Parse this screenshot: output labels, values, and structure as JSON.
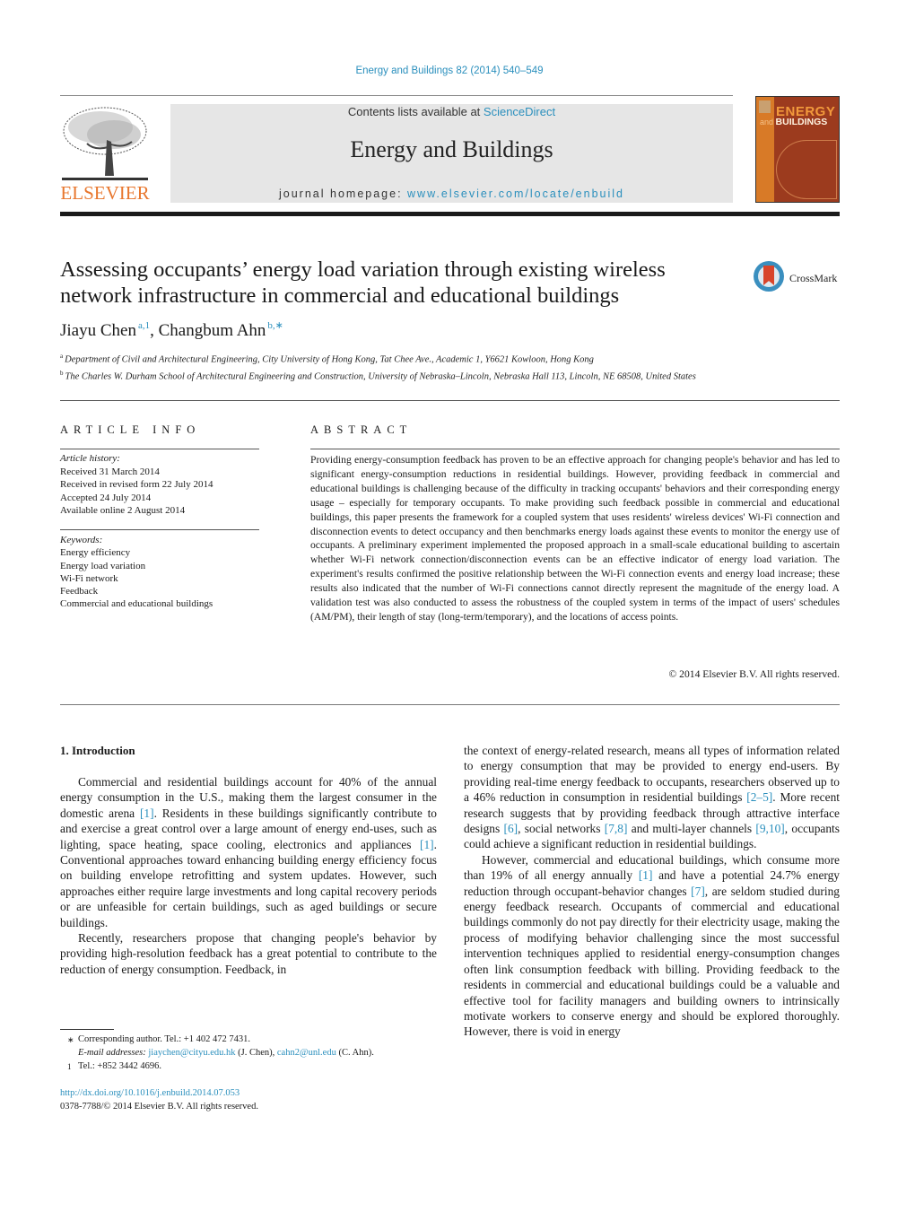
{
  "header": {
    "journal_ref": "Energy and Buildings 82 (2014) 540–549",
    "contents_prefix": "Contents lists available at ",
    "contents_link": "ScienceDirect",
    "journal_name": "Energy and Buildings",
    "homepage_prefix": "journal homepage: ",
    "homepage_link": "www.elsevier.com/locate/enbuild",
    "publisher_logo_text": "ELSEVIER",
    "cover": {
      "title_line1": "ENERGY",
      "title_and": "and ",
      "title_line2": "BUILDINGS"
    },
    "crossmark_label": "CrossMark",
    "colors": {
      "link": "#2a8fbd",
      "elsevier_orange": "#e8772e",
      "banner_bg": "#e6e6e6"
    }
  },
  "article": {
    "title": "Assessing occupants’ energy load variation through existing wireless network infrastructure in commercial and educational buildings",
    "authors": [
      {
        "name": "Jiayu Chen",
        "marks": "a,1"
      },
      {
        "name": "Changbum Ahn",
        "marks": "b,∗"
      }
    ],
    "affiliations": [
      {
        "mark": "a",
        "text": "Department of Civil and Architectural Engineering, City University of Hong Kong, Tat Chee Ave., Academic 1, Y6621 Kowloon, Hong Kong"
      },
      {
        "mark": "b",
        "text": "The Charles W. Durham School of Architectural Engineering and Construction, University of Nebraska–Lincoln, Nebraska Hall 113, Lincoln, NE 68508, United States"
      }
    ]
  },
  "article_info": {
    "heading": "ARTICLE INFO",
    "history_label": "Article history:",
    "history": [
      "Received 31 March 2014",
      "Received in revised form 22 July 2014",
      "Accepted 24 July 2014",
      "Available online 2 August 2014"
    ],
    "keywords_label": "Keywords:",
    "keywords": [
      "Energy efficiency",
      "Energy load variation",
      "Wi-Fi network",
      "Feedback",
      "Commercial and educational buildings"
    ]
  },
  "abstract": {
    "heading": "ABSTRACT",
    "text": "Providing energy-consumption feedback has proven to be an effective approach for changing people's behavior and has led to significant energy-consumption reductions in residential buildings. However, providing feedback in commercial and educational buildings is challenging because of the difficulty in tracking occupants' behaviors and their corresponding energy usage – especially for temporary occupants. To make providing such feedback possible in commercial and educational buildings, this paper presents the framework for a coupled system that uses residents' wireless devices' Wi-Fi connection and disconnection events to detect occupancy and then benchmarks energy loads against these events to monitor the energy use of occupants. A preliminary experiment implemented the proposed approach in a small-scale educational building to ascertain whether Wi-Fi network connection/disconnection events can be an effective indicator of energy load variation. The experiment's results confirmed the positive relationship between the Wi-Fi connection events and energy load increase; these results also indicated that the number of Wi-Fi connections cannot directly represent the magnitude of the energy load. A validation test was also conducted to assess the robustness of the coupled system in terms of the impact of users' schedules (AM/PM), their length of stay (long-term/temporary), and the locations of access points.",
    "copyright": "© 2014 Elsevier B.V. All rights reserved."
  },
  "body": {
    "section_heading": "1.  Introduction",
    "left_paragraphs": [
      [
        {
          "t": "Commercial and residential buildings account for 40% of the annual energy consumption in the U.S., making them the largest consumer in the domestic arena "
        },
        {
          "ref": "[1]"
        },
        {
          "t": ". Residents in these buildings significantly contribute to and exercise a great control over a large amount of energy end-uses, such as lighting, space heating, space cooling, electronics and appliances "
        },
        {
          "ref": "[1]"
        },
        {
          "t": ". Conventional approaches toward enhancing building energy efficiency focus on building envelope retrofitting and system updates. However, such approaches either require large investments and long capital recovery periods or are unfeasible for certain buildings, such as aged buildings or secure buildings."
        }
      ],
      [
        {
          "t": "Recently, researchers propose that changing people's behavior by providing high-resolution feedback has a great potential to contribute to the reduction of energy consumption. Feedback, in"
        }
      ]
    ],
    "right_paragraphs": [
      [
        {
          "t": "the context of energy-related research, means all types of information related to energy consumption that may be provided to energy end-users. By providing real-time energy feedback to occupants, researchers observed up to a 46% reduction in consumption in residential buildings "
        },
        {
          "ref": "[2–5]"
        },
        {
          "t": ". More recent research suggests that by providing feedback through attractive interface designs "
        },
        {
          "ref": "[6]"
        },
        {
          "t": ", social networks "
        },
        {
          "ref": "[7,8]"
        },
        {
          "t": " and multi-layer channels "
        },
        {
          "ref": "[9,10]"
        },
        {
          "t": ", occupants could achieve a significant reduction in residential buildings."
        }
      ],
      [
        {
          "t": "However, commercial and educational buildings, which consume more than 19% of all energy annually "
        },
        {
          "ref": "[1]"
        },
        {
          "t": " and have a potential 24.7% energy reduction through occupant-behavior changes "
        },
        {
          "ref": "[7]"
        },
        {
          "t": ", are seldom studied during energy feedback research. Occupants of commercial and educational buildings commonly do not pay directly for their electricity usage, making the process of modifying behavior challenging since the most successful intervention techniques applied to residential energy-consumption changes often link consumption feedback with billing. Providing feedback to the residents in commercial and educational buildings could be a valuable and effective tool for facility managers and building owners to intrinsically motivate workers to conserve energy and should be explored thoroughly. However, there is void in energy"
        }
      ]
    ]
  },
  "footnotes": {
    "corresponding_mark": "∗",
    "corresponding": "Corresponding author. Tel.: +1 402 472 7431.",
    "email_label": "E-mail addresses:",
    "email1": "jiaychen@cityu.edu.hk",
    "email1_owner": " (J. Chen), ",
    "email2": "cahn2@unl.edu",
    "email2_owner": " (C. Ahn).",
    "note1_mark": "1",
    "note1": "Tel.: +852 3442 4696.",
    "doi_link": "http://dx.doi.org/10.1016/j.enbuild.2014.07.053",
    "issn_line": "0378-7788/© 2014 Elsevier B.V. All rights reserved."
  }
}
